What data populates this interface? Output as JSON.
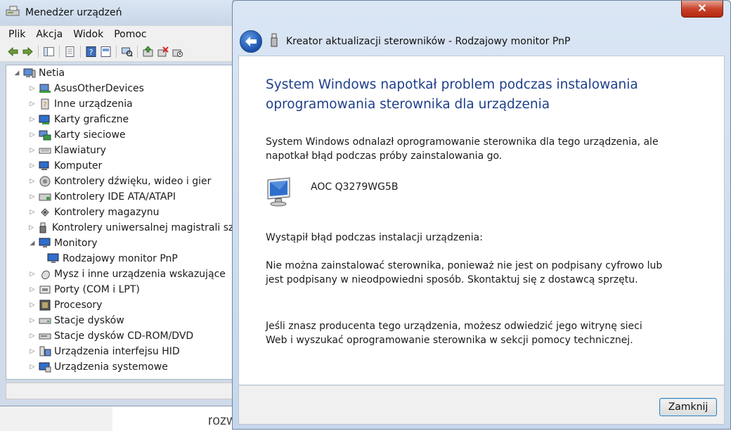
{
  "background": {
    "partial_text": "rozw"
  },
  "device_manager": {
    "title": "Menedżer urządzeń",
    "menu": [
      "Plik",
      "Akcja",
      "Widok",
      "Pomoc"
    ],
    "tree_root": "Netia",
    "tree_items": [
      {
        "label": "AsusOtherDevices",
        "icon": "network-device-icon",
        "expanded": false
      },
      {
        "label": "Inne urządzenia",
        "icon": "unknown-device-icon",
        "expanded": false
      },
      {
        "label": "Karty graficzne",
        "icon": "display-adapter-icon",
        "expanded": false
      },
      {
        "label": "Karty sieciowe",
        "icon": "network-adapter-icon",
        "expanded": false
      },
      {
        "label": "Klawiatury",
        "icon": "keyboard-icon",
        "expanded": false
      },
      {
        "label": "Komputer",
        "icon": "computer-icon",
        "expanded": false
      },
      {
        "label": "Kontrolery dźwięku, wideo i gier",
        "icon": "speaker-icon",
        "expanded": false
      },
      {
        "label": "Kontrolery IDE ATA/ATAPI",
        "icon": "ide-controller-icon",
        "expanded": false
      },
      {
        "label": "Kontrolery magazynu",
        "icon": "storage-controller-icon",
        "expanded": false
      },
      {
        "label": "Kontrolery uniwersalnej magistrali sze",
        "icon": "usb-icon",
        "expanded": false
      },
      {
        "label": "Monitory",
        "icon": "monitor-icon",
        "expanded": true
      },
      {
        "label": "Rodzajowy monitor PnP",
        "icon": "monitor-icon",
        "child": true
      },
      {
        "label": "Mysz i inne urządzenia wskazujące",
        "icon": "mouse-icon",
        "expanded": false
      },
      {
        "label": "Porty (COM i LPT)",
        "icon": "port-icon",
        "expanded": false
      },
      {
        "label": "Procesory",
        "icon": "processor-icon",
        "expanded": false
      },
      {
        "label": "Stacje dysków",
        "icon": "disk-drive-icon",
        "expanded": false
      },
      {
        "label": "Stacje dysków CD-ROM/DVD",
        "icon": "cdrom-icon",
        "expanded": false
      },
      {
        "label": "Urządzenia interfejsu HID",
        "icon": "hid-icon",
        "expanded": false
      },
      {
        "label": "Urządzenia systemowe",
        "icon": "system-device-icon",
        "expanded": false
      }
    ]
  },
  "wizard": {
    "title": "Kreator aktualizacji sterowników - Rodzajowy monitor PnP",
    "close_symbol": "✕",
    "heading": "System Windows napotkał problem podczas instalowania oprogramowania sterownika dla urządzenia",
    "intro": "System Windows odnalazł oprogramowanie sterownika dla tego urządzenia, ale napotkał błąd podczas próby zainstalowania go.",
    "device_name": "AOC Q3279WG5B",
    "error_label": "Wystąpił błąd podczas instalacji urządzenia:",
    "error_detail": "Nie można zainstalować sterownika, ponieważ nie jest on podpisany cyfrowo lub jest podpisany w nieodpowiedni sposób. Skontaktuj się z dostawcą sprzętu.",
    "manufacturer_hint": "Jeśli znasz producenta tego urządzenia, możesz odwiedzić jego witrynę sieci Web i wyszukać oprogramowanie sterownika w sekcji pomocy technicznej.",
    "close_button": "Zamknij"
  },
  "colors": {
    "heading_blue": "#1e3f8a",
    "close_red": "#c8432a",
    "button_focus": "#3c7fb1"
  }
}
